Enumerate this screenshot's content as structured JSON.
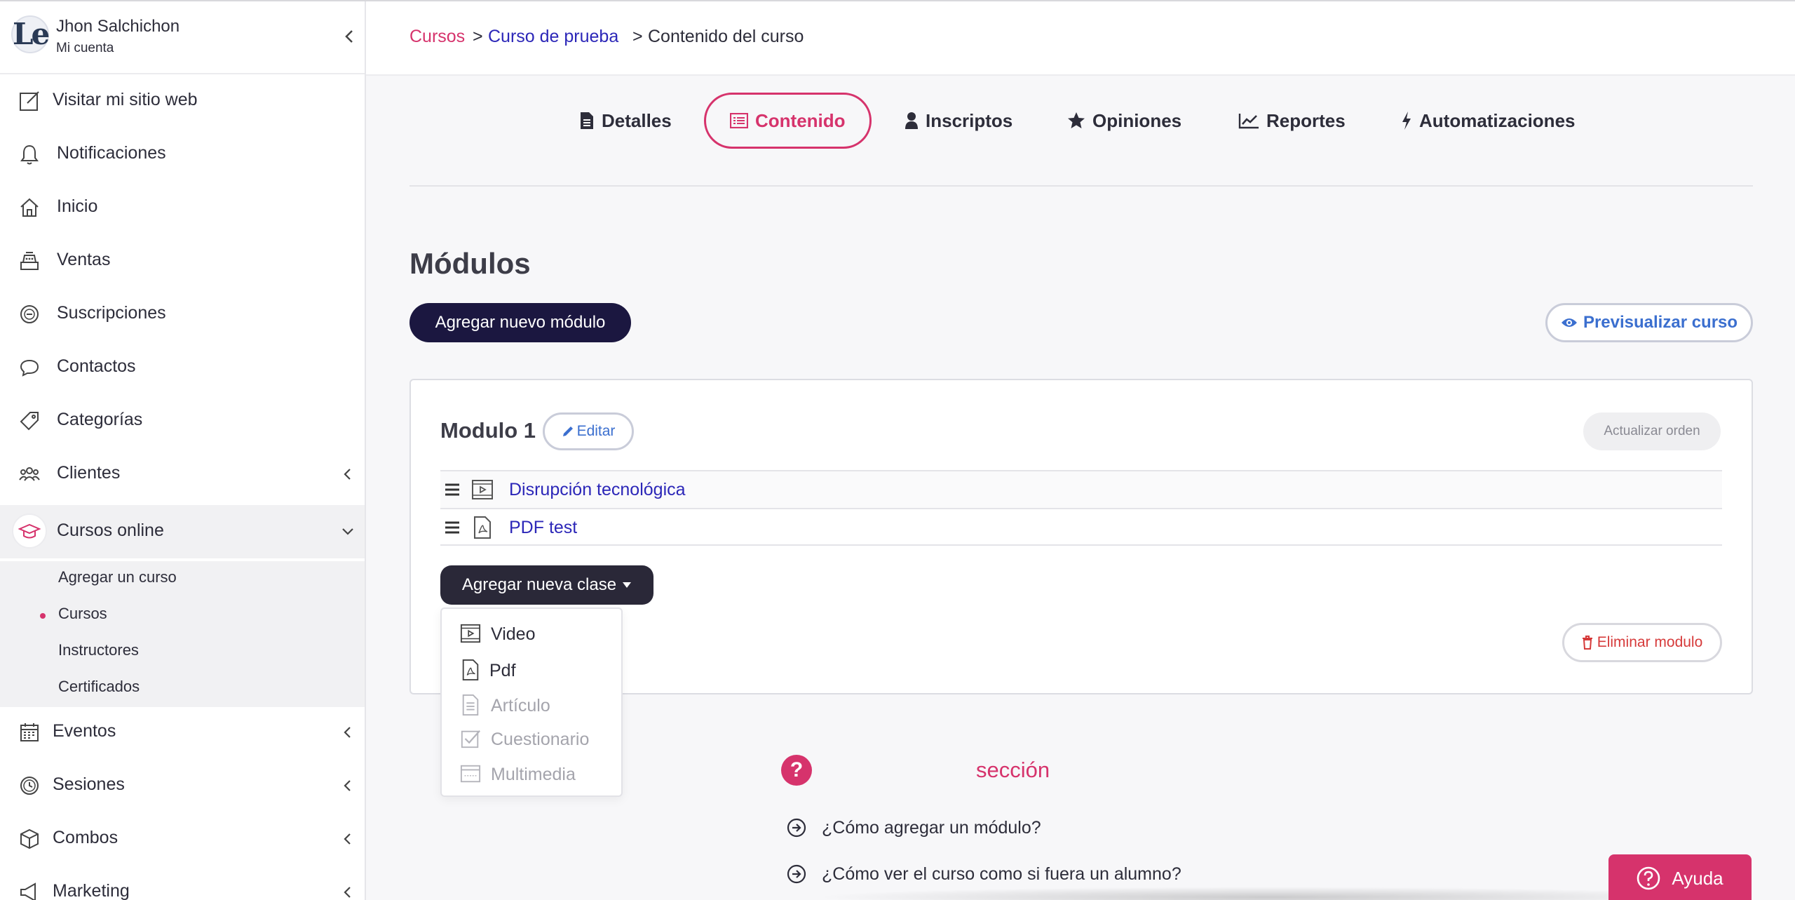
{
  "user": {
    "name": "Jhon Salchichon",
    "subtitle": "Mi cuenta",
    "avatar_text": "Le"
  },
  "sidebar": {
    "items": [
      {
        "label": "Visitar mi sitio web"
      },
      {
        "label": "Notificaciones"
      },
      {
        "label": "Inicio"
      },
      {
        "label": "Ventas"
      },
      {
        "label": "Suscripciones"
      },
      {
        "label": "Contactos"
      },
      {
        "label": "Categorías"
      },
      {
        "label": "Clientes"
      },
      {
        "label": "Cursos online"
      },
      {
        "label": "Eventos"
      },
      {
        "label": "Sesiones"
      },
      {
        "label": "Combos"
      },
      {
        "label": "Marketing"
      }
    ],
    "subitems": [
      {
        "label": "Agregar un curso"
      },
      {
        "label": "Cursos"
      },
      {
        "label": "Instructores"
      },
      {
        "label": "Certificados"
      }
    ]
  },
  "breadcrumb": {
    "c1": "Cursos",
    "sep": ">",
    "c2": "Curso de prueba",
    "c3": "Contenido del curso"
  },
  "tabs": [
    {
      "label": "Detalles"
    },
    {
      "label": "Contenido"
    },
    {
      "label": "Inscriptos"
    },
    {
      "label": "Opiniones"
    },
    {
      "label": "Reportes"
    },
    {
      "label": "Automatizaciones"
    }
  ],
  "main": {
    "title": "Módulos",
    "add_module": "Agregar nuevo módulo",
    "preview": "Previsualizar curso"
  },
  "module": {
    "title": "Modulo 1",
    "edit": "Editar",
    "update_order": "Actualizar orden",
    "lessons": [
      {
        "name": "Disrupción tecnológica",
        "type": "video"
      },
      {
        "name": "PDF test",
        "type": "pdf"
      }
    ],
    "add_class": "Agregar nueva clase",
    "delete": "Eliminar modulo"
  },
  "dropdown": {
    "items": [
      {
        "label": "Video",
        "enabled": true
      },
      {
        "label": "Pdf",
        "enabled": true
      },
      {
        "label": "Artículo",
        "enabled": false
      },
      {
        "label": "Cuestionario",
        "enabled": false
      },
      {
        "label": "Multimedia",
        "enabled": false
      }
    ]
  },
  "help": {
    "title": "sección",
    "faqs": [
      {
        "q": "¿Cómo agregar un módulo?"
      },
      {
        "q": "¿Cómo ver el curso como si fuera un alumno?"
      }
    ],
    "button": "Ayuda"
  },
  "colors": {
    "accent": "#d6336c",
    "link": "#2c27b8",
    "primary_dark": "#1b1740"
  }
}
